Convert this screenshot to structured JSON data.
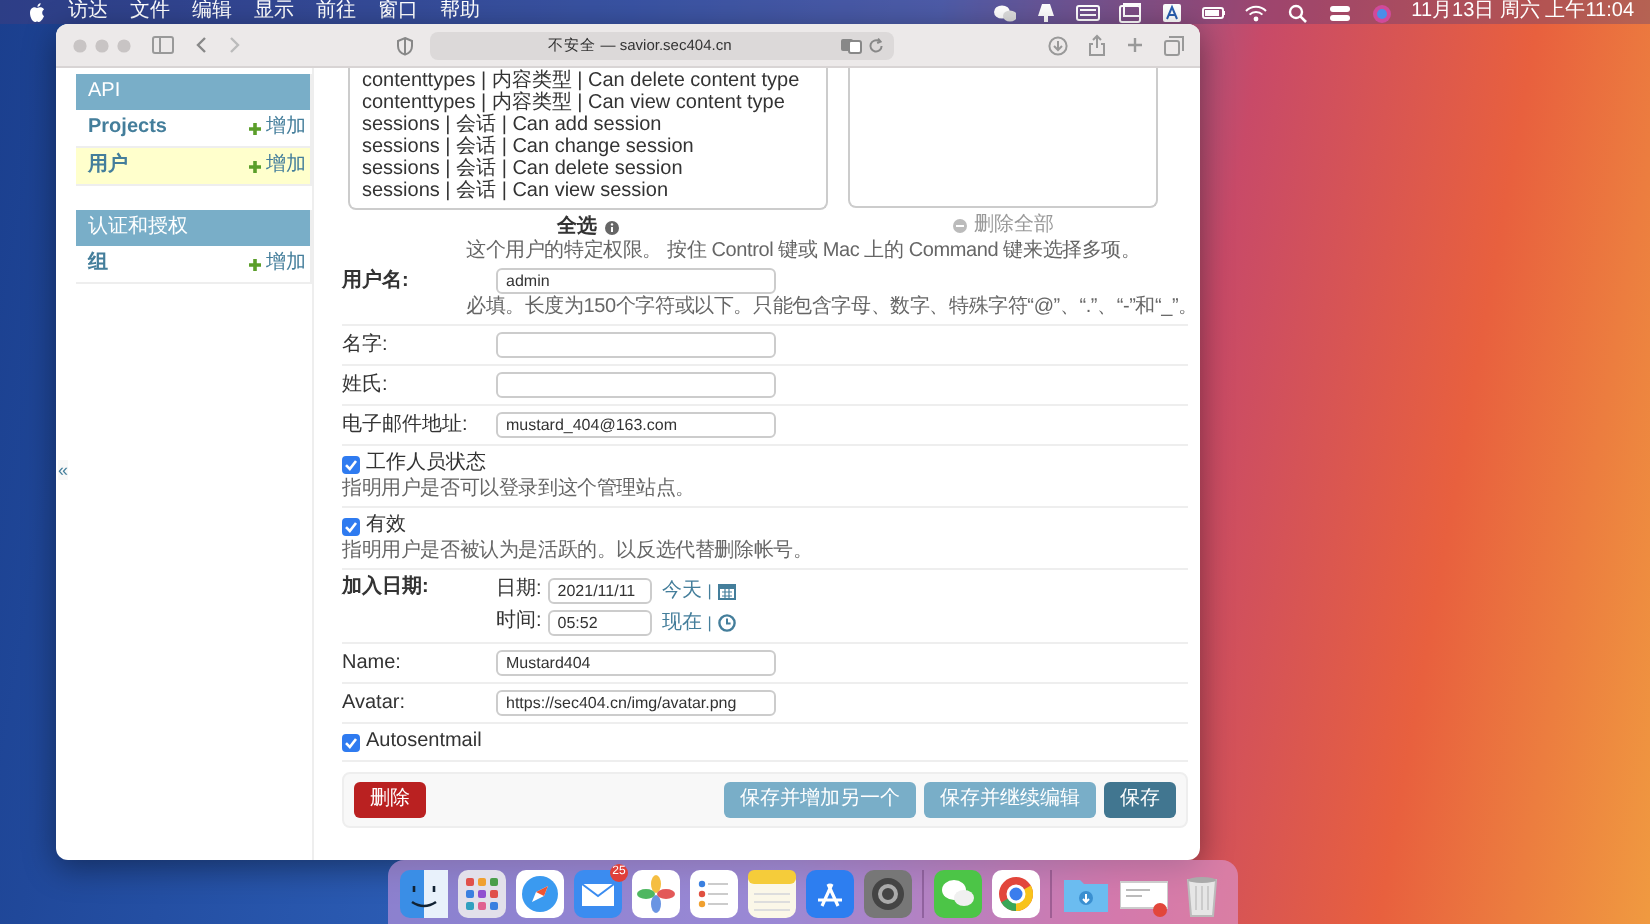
{
  "menubar": {
    "menus": [
      "访达",
      "文件",
      "编辑",
      "显示",
      "前往",
      "窗口",
      "帮助"
    ],
    "status_icons": [
      {
        "kind": "chat"
      },
      {
        "kind": "lamp"
      },
      {
        "kind": "input"
      },
      {
        "kind": "window"
      },
      {
        "kind": "letter"
      },
      {
        "kind": "battery"
      },
      {
        "kind": "wifi"
      },
      {
        "kind": "search"
      },
      {
        "kind": "toggles"
      },
      {
        "kind": "orb"
      }
    ],
    "clock": "11月13日 周六 上午11:04"
  },
  "browser": {
    "address": "不安全 — savior.sec404.cn"
  },
  "sidebar": {
    "sections": [
      {
        "title": "API",
        "items": [
          {
            "label": "Projects",
            "action": "增加",
            "selected": false
          },
          {
            "label": "用户",
            "action": "增加",
            "selected": true
          }
        ]
      },
      {
        "title": "认证和授权",
        "items": [
          {
            "label": "组",
            "action": "增加",
            "selected": false
          }
        ]
      }
    ],
    "collapse_toggle": "«"
  },
  "form": {
    "permissions": {
      "available": [
        "contenttypes | 内容类型 | Can delete content type",
        "contenttypes | 内容类型 | Can view content type",
        "sessions | 会话 | Can add session",
        "sessions | 会话 | Can change session",
        "sessions | 会话 | Can delete session",
        "sessions | 会话 | Can view session"
      ],
      "choose_all": "全选",
      "remove_all": "删除全部",
      "help": "这个用户的特定权限。 按住 Control 键或 Mac 上的 Command 键来选择多项。"
    },
    "fields": [
      {
        "kind": "text",
        "label": "用户名:",
        "required": true,
        "value": "admin",
        "help": "必填。长度为150个字符或以下。只能包含字母、数字、特殊字符“@”、“.”、“-”和“_”。"
      },
      {
        "kind": "text",
        "label": "名字:",
        "required": false
      },
      {
        "kind": "text",
        "label": "姓氏:",
        "required": false
      },
      {
        "kind": "text",
        "label": "电子邮件地址:",
        "required": false,
        "value": "mustard_404@163.com"
      },
      {
        "kind": "checkbox",
        "label": "工作人员状态",
        "checked": true,
        "help": "指明用户是否可以登录到这个管理站点。"
      },
      {
        "kind": "checkbox",
        "label": "有效",
        "checked": true,
        "help": "指明用户是否被认为是活跃的。以反选代替删除帐号。"
      },
      {
        "kind": "datetime",
        "label": "加入日期:",
        "required": true,
        "parts": [
          {
            "label": "日期:",
            "value": "2021/11/11",
            "shortcut": "今天",
            "separator": "|",
            "kind": "date"
          },
          {
            "label": "时间:",
            "value": "05:52",
            "shortcut": "现在",
            "separator": "|",
            "kind": "time"
          }
        ]
      },
      {
        "kind": "text",
        "label": "Name:",
        "required": false,
        "value": "Mustard404"
      },
      {
        "kind": "text",
        "label": "Avatar:",
        "required": false,
        "value": "https://sec404.cn/img/avatar.png"
      },
      {
        "kind": "checkbox",
        "label": "Autosentmail",
        "checked": true
      }
    ]
  },
  "submit": {
    "delete": "删除",
    "buttons": [
      {
        "label": "保存并增加另一个",
        "kind": "secondary"
      },
      {
        "label": "保存并继续编辑",
        "kind": "secondary"
      },
      {
        "label": "保存",
        "kind": "primary"
      }
    ]
  },
  "dock": [
    {
      "kind": "finder"
    },
    {
      "kind": "launchpad"
    },
    {
      "kind": "safari"
    },
    {
      "kind": "mail",
      "badge": "25"
    },
    {
      "kind": "photos"
    },
    {
      "kind": "reminders"
    },
    {
      "kind": "notes"
    },
    {
      "kind": "appstore"
    },
    {
      "kind": "settings"
    },
    {
      "kind": "separator"
    },
    {
      "kind": "wechat"
    },
    {
      "kind": "chrome"
    },
    {
      "kind": "separator"
    },
    {
      "kind": "downloads"
    },
    {
      "kind": "thumbnail"
    },
    {
      "kind": "trash"
    }
  ]
}
